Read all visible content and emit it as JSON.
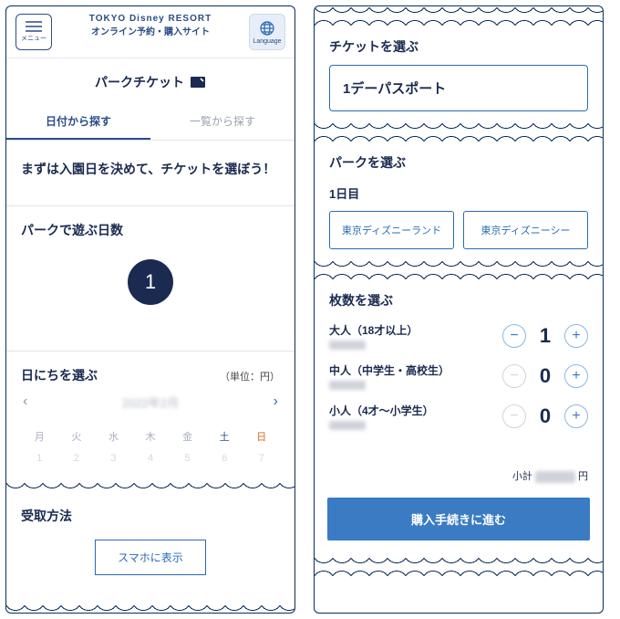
{
  "header": {
    "menu": "メニュー",
    "lang": "Language",
    "logo_top": "TOKYO Disney RESORT",
    "logo_sub": "オンライン予約・購入サイト"
  },
  "title": "パークチケット",
  "tabs": {
    "byDate": "日付から探す",
    "byList": "一覧から探す"
  },
  "intro": "まずは入園日を決めて、チケットを選ぼう！",
  "days": {
    "label": "パークで遊ぶ日数",
    "value": "1"
  },
  "date": {
    "label": "日にちを選ぶ",
    "unit": "（単位：円）",
    "dow": [
      "月",
      "火",
      "水",
      "木",
      "金",
      "土",
      "日"
    ],
    "nums": [
      "1",
      "2",
      "3",
      "4",
      "5",
      "6",
      "7"
    ]
  },
  "delivery": {
    "label": "受取方法",
    "btn": "スマホに表示"
  },
  "ticket": {
    "head": "チケットを選ぶ",
    "name": "1デーパスポート"
  },
  "park": {
    "head": "パークを選ぶ",
    "day": "1日目",
    "land": "東京ディズニーランド",
    "sea": "東京ディズニーシー"
  },
  "qty": {
    "head": "枚数を選ぶ",
    "rows": [
      {
        "label": "大人（18才以上）",
        "val": "1",
        "minusDisabled": false
      },
      {
        "label": "中人（中学生・高校生）",
        "val": "0",
        "minusDisabled": true
      },
      {
        "label": "小人（4才〜小学生）",
        "val": "0",
        "minusDisabled": true
      }
    ]
  },
  "subtotal": {
    "label": "小計",
    "yen": "円"
  },
  "proceed": "購入手続きに進む"
}
